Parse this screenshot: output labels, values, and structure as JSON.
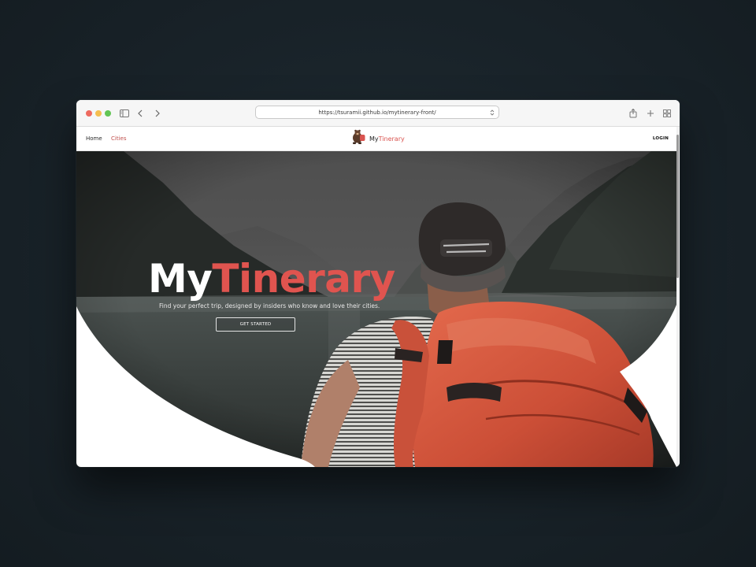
{
  "browser": {
    "url": "https://tsuramii.github.io/mytinerary-front/"
  },
  "nav": {
    "home_label": "Home",
    "cities_label": "Cities",
    "brand_my": "My",
    "brand_tinerary": "Tinerary",
    "login_label": "LOGIN"
  },
  "hero": {
    "title_my": "My",
    "title_tinerary": "Tinerary",
    "subtitle": "Find your perfect trip, designed by insiders who know and love their cities.",
    "cta_label": "GET STARTED"
  },
  "colors": {
    "accent": "#e0544f",
    "backpack": "#d8553d",
    "page_bg": "#19232a"
  },
  "icons": [
    "sidebar-toggle-icon",
    "back-chevron-icon",
    "forward-chevron-icon",
    "reload-icon",
    "share-icon",
    "new-tab-plus-icon",
    "tab-overview-icon",
    "brand-logo-icon"
  ]
}
